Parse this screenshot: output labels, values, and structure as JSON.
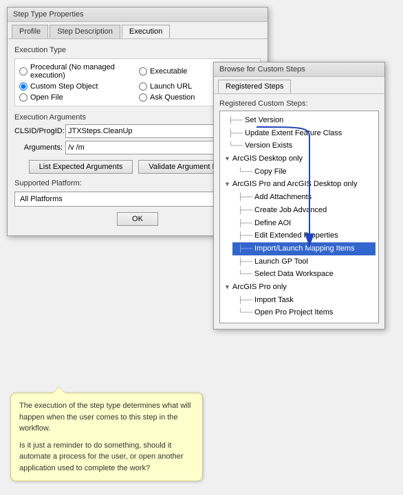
{
  "dialog": {
    "title": "Step Type Properties",
    "tabs": [
      {
        "id": "profile",
        "label": "Profile"
      },
      {
        "id": "step-description",
        "label": "Step Description"
      },
      {
        "id": "execution",
        "label": "Execution",
        "active": true
      }
    ],
    "execution": {
      "execution_type_label": "Execution Type",
      "radios": [
        {
          "id": "procedural",
          "label": "Procedural (No managed execution)",
          "checked": false,
          "col": 0
        },
        {
          "id": "executable",
          "label": "Executable",
          "checked": false,
          "col": 1
        },
        {
          "id": "custom-step",
          "label": "Custom Step Object",
          "checked": true,
          "col": 0
        },
        {
          "id": "launch-url",
          "label": "Launch URL",
          "checked": false,
          "col": 1
        },
        {
          "id": "open-file",
          "label": "Open File",
          "checked": false,
          "col": 0
        },
        {
          "id": "ask-question",
          "label": "Ask Question",
          "checked": false,
          "col": 1
        }
      ],
      "arguments_label": "Execution Arguments",
      "clsid_label": "CLSID/ProgID:",
      "clsid_value": "JTXSteps.CleanUp",
      "arguments_field_label": "Arguments:",
      "arguments_value": "/v /m",
      "list_expected_btn": "List Expected Arguments",
      "validate_btn": "Validate Argument Names",
      "platform_label": "Supported Platform:",
      "platform_value": "All Platforms",
      "ok_btn": "OK"
    }
  },
  "browse_dialog": {
    "title": "Browse for Custom Steps",
    "tab": "Registered Steps",
    "registered_label": "Registered Custom Steps:",
    "tree": [
      {
        "type": "item",
        "label": "Set Version",
        "indent": 1
      },
      {
        "type": "item",
        "label": "Update Extent Feature Class",
        "indent": 1
      },
      {
        "type": "item",
        "label": "Version Exists",
        "indent": 1
      },
      {
        "type": "group",
        "label": "ArcGIS Desktop only",
        "indent": 0,
        "children": [
          {
            "label": "Copy File"
          }
        ]
      },
      {
        "type": "group",
        "label": "ArcGIS Pro and ArcGIS Desktop only",
        "indent": 0,
        "children": [
          {
            "label": "Add Attachments"
          },
          {
            "label": "Create Job Advanced"
          },
          {
            "label": "Define AOI"
          },
          {
            "label": "Edit Extended Properties"
          },
          {
            "label": "Import/Launch Mapping Items",
            "highlighted": true
          },
          {
            "label": "Launch GP Tool"
          },
          {
            "label": "Select Data Workspace"
          }
        ]
      },
      {
        "type": "group",
        "label": "ArcGIS Pro only",
        "indent": 0,
        "children": [
          {
            "label": "Import Task"
          },
          {
            "label": "Open Pro Project Items"
          }
        ]
      }
    ]
  },
  "tooltip": {
    "text1": "The execution of the step type determines what will happen when the user comes to this step in the workflow.",
    "text2": "Is it just a reminder to do something, should it automate a process for the user, or open another application used to complete the work?"
  }
}
